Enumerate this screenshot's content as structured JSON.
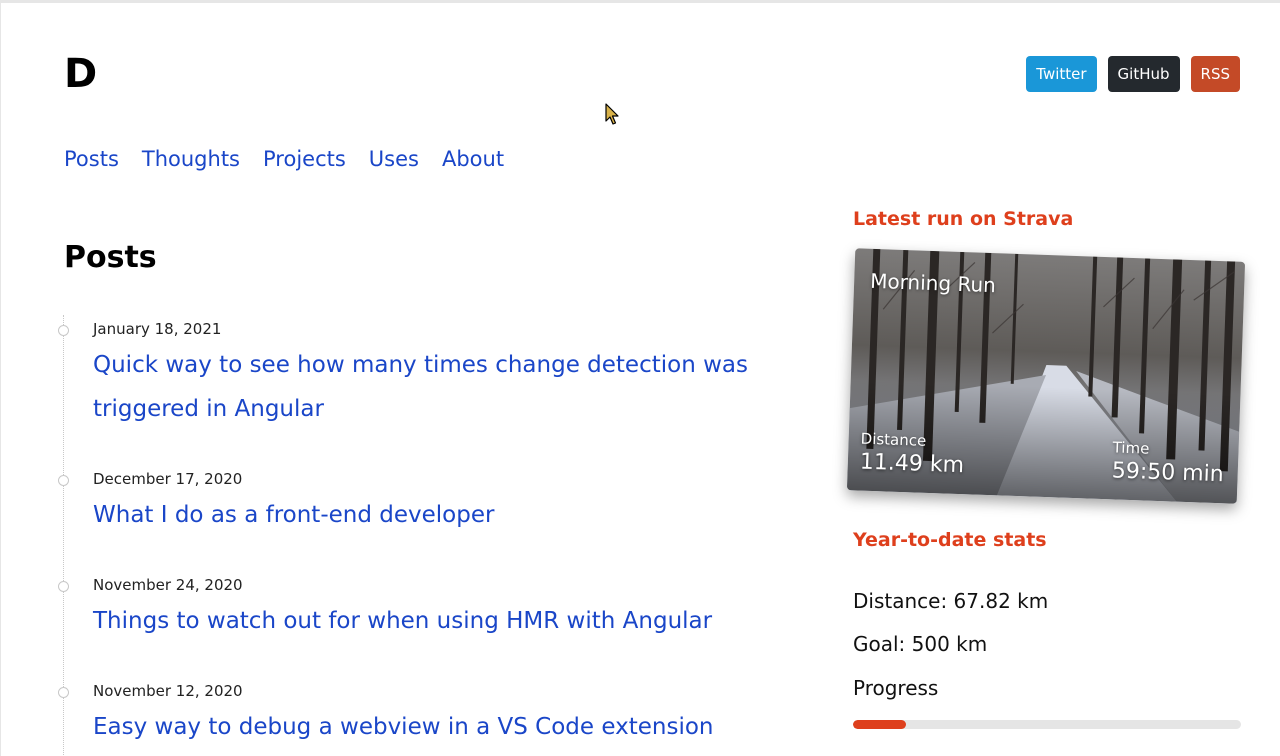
{
  "site": {
    "logo": "D"
  },
  "social": [
    {
      "label": "Twitter",
      "color": "#1a97d8"
    },
    {
      "label": "GitHub",
      "color": "#24292e"
    },
    {
      "label": "RSS",
      "color": "#c44a27"
    }
  ],
  "nav": [
    "Posts",
    "Thoughts",
    "Projects",
    "Uses",
    "About"
  ],
  "main": {
    "heading": "Posts",
    "posts": [
      {
        "date": "January 18, 2021",
        "title": "Quick way to see how many times change detection was triggered in Angular"
      },
      {
        "date": "December 17, 2020",
        "title": "What I do as a front-end developer"
      },
      {
        "date": "November 24, 2020",
        "title": "Things to watch out for when using HMR with Angular"
      },
      {
        "date": "November 12, 2020",
        "title": "Easy way to debug a webview in a VS Code extension"
      }
    ]
  },
  "sidebar": {
    "latest_run": {
      "heading": "Latest run on Strava",
      "title": "Morning Run",
      "distance_label": "Distance",
      "distance_value": "11.49 km",
      "time_label": "Time",
      "time_value": "59:50 min"
    },
    "ytd": {
      "heading": "Year-to-date stats",
      "distance": "Distance: 67.82 km",
      "goal": "Goal: 500 km",
      "progress_label": "Progress",
      "progress_fraction": 0.1356
    }
  },
  "colors": {
    "accent": "#de3f1c",
    "link": "#1a46c8"
  }
}
